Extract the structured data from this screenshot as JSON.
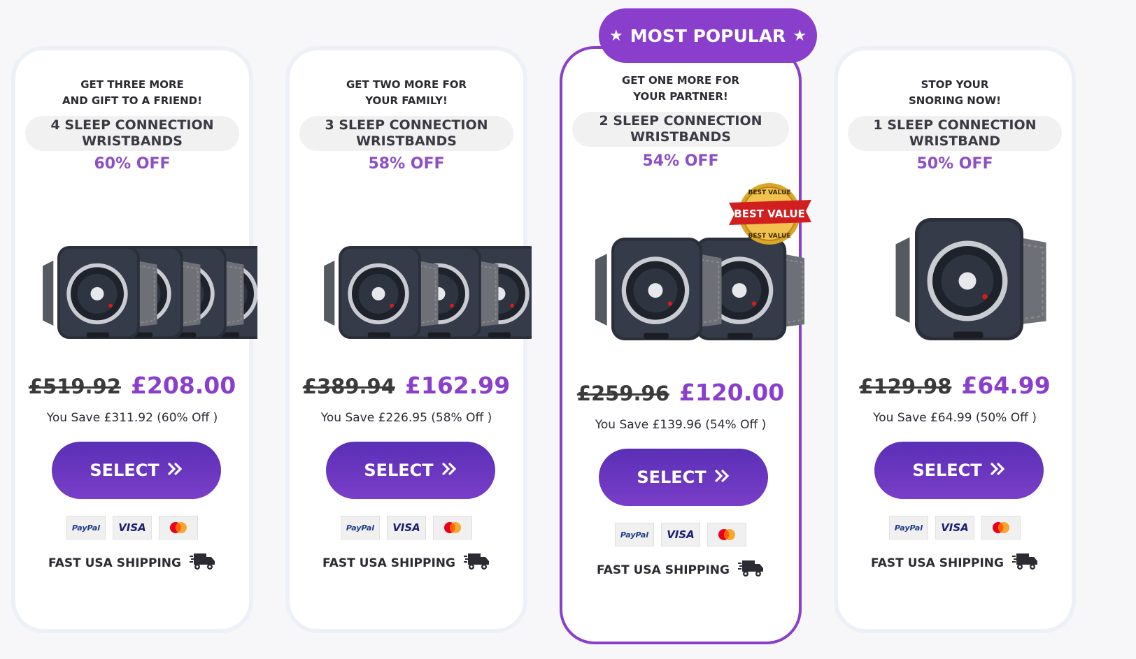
{
  "banner": {
    "label": "MOST POPULAR",
    "star_icon": "star-icon"
  },
  "colors": {
    "accent": "#8a3fcc",
    "button": "#6535bd",
    "discount": "#8d4fc6"
  },
  "cards": [
    {
      "headline": "GET THREE MORE\nAND GIFT TO A FRIEND!",
      "product": "4 SLEEP CONNECTION\nWRISTBANDS",
      "discount": "60% OFF",
      "units": 4,
      "old_price": "£519.92",
      "new_price": "£208.00",
      "savings": "You Save £311.92 (60% Off )",
      "select_label": "SELECT",
      "shipping": "FAST USA SHIPPING"
    },
    {
      "headline": "GET TWO MORE FOR\nYOUR FAMILY!",
      "product": "3 SLEEP CONNECTION\nWRISTBANDS",
      "discount": "58% OFF",
      "units": 3,
      "old_price": "£389.94",
      "new_price": "£162.99",
      "savings": "You Save £226.95 (58% Off )",
      "select_label": "SELECT",
      "shipping": "FAST USA SHIPPING"
    },
    {
      "headline": "GET ONE MORE FOR\nYOUR PARTNER!",
      "product": "2 SLEEP CONNECTION\nWRISTBANDS",
      "discount": "54% OFF",
      "units": 2,
      "old_price": "£259.96",
      "new_price": "£120.00",
      "savings": "You Save £139.96 (54% Off )",
      "select_label": "SELECT",
      "shipping": "FAST USA SHIPPING",
      "seal_top": "BEST VALUE",
      "seal_main": "BEST VALUE",
      "seal_bottom": "BEST VALUE"
    },
    {
      "headline": "STOP YOUR\nSNORING NOW!",
      "product": "1 SLEEP CONNECTION\nWRISTBAND",
      "discount": "50% OFF",
      "units": 1,
      "old_price": "£129.98",
      "new_price": "£64.99",
      "savings": "You Save £64.99 (50% Off )",
      "select_label": "SELECT",
      "shipping": "FAST USA SHIPPING"
    }
  ],
  "payments": {
    "paypal": "PayPal",
    "visa": "VISA",
    "mastercard": "mastercard-icon"
  }
}
